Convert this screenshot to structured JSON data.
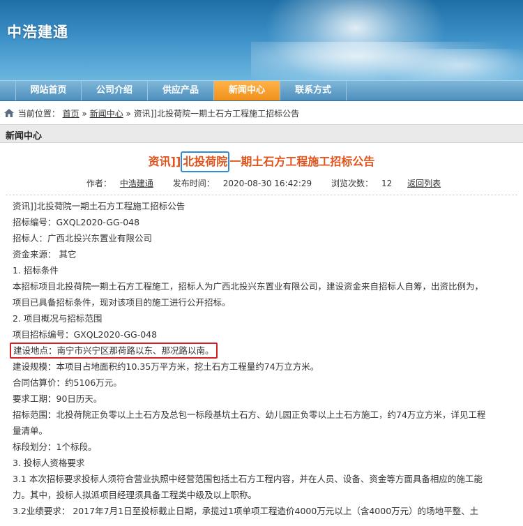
{
  "banner": {
    "logo": "中浩建通"
  },
  "nav": {
    "items": [
      "网站首页",
      "公司介绍",
      "供应产品",
      "新闻中心",
      "联系方式"
    ],
    "active_index": 3,
    "active_color": "#f0901a"
  },
  "breadcrumb": {
    "prefix": "当前位置：",
    "home": "首页",
    "sep1": "»",
    "news": "新闻中心",
    "sep2": "»",
    "current": "资讯]]北投荷院一期土石方工程施工招标公告"
  },
  "section": {
    "title": "新闻中心"
  },
  "article": {
    "title_pre": "资讯]]",
    "title_highlight": "北投荷院",
    "title_post": "一期土石方工程施工招标公告",
    "title_color": "#e0531b",
    "highlight_color": "#2e8ad6",
    "meta": {
      "author_label": "作者：",
      "author": "中浩建通",
      "time_label": "发布时间：",
      "time": "2020-08-30 16:42:29",
      "views_label": "浏览次数：",
      "views": "12",
      "back": "返回列表"
    },
    "lines": [
      "资讯]]北投荷院一期土石方工程施工招标公告",
      "招标编号：GXQL2020-GG-048",
      "招标人：广西北投兴东置业有限公司",
      "资金来源： 其它",
      "1. 招标条件",
      "本招标项目北投荷院一期土石方工程施工，招标人为广西北投兴东置业有限公司，建设资金来自招标人自筹，出资比例为，",
      "项目已具备招标条件，现对该项目的施工进行公开招标。",
      "2. 项目概况与招标范围",
      "项目招标编号：GXQL2020-GG-048",
      "建设地点：南宁市兴宁区那荷路以东、那况路以南。",
      "建设规模：本项目占地面积约10.35万平方米，挖土石方工程量约74万立方米。",
      "合同估算价：约5106万元。",
      "要求工期：90日历天。",
      "招标范围：北投荷院正负零以上土石方及总包一标段基坑土石方、幼儿园正负零以上土石方施工，约74万立方米，详见工程",
      "量清单。",
      "标段划分：1个标段。",
      "3. 投标人资格要求",
      "3.1 本次招标要求投标人须符合营业执照中经营范围包括土石方工程内容，并在人员、设备、资金等方面具备相应的施工能",
      "力。其中，投标人拟派项目经理须具备工程类中级及以上职称。",
      "3.2业绩要求：  2017年7月1日至投标截止日期，承揽过1项单项工程造价4000万元以上（含4000万元）的场地平整、土"
    ],
    "boxed_line_index": 9,
    "box_color": "#d42121"
  }
}
